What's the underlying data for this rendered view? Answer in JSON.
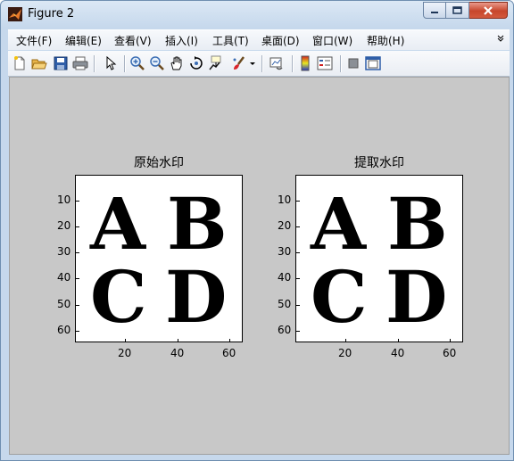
{
  "window": {
    "title": "Figure 2",
    "app_icon": "matlab-logo-icon",
    "controls": [
      "minimize-icon",
      "maximize-icon",
      "close-icon"
    ]
  },
  "menubar": {
    "items": [
      {
        "label": "文件(F)"
      },
      {
        "label": "编辑(E)"
      },
      {
        "label": "查看(V)"
      },
      {
        "label": "插入(I)"
      },
      {
        "label": "工具(T)"
      },
      {
        "label": "桌面(D)"
      },
      {
        "label": "窗口(W)"
      },
      {
        "label": "帮助(H)"
      }
    ]
  },
  "toolbar": {
    "icons": [
      "new-figure-icon",
      "open-file-icon",
      "save-icon",
      "print-icon",
      "select-arrow-icon",
      "zoom-in-icon",
      "zoom-out-icon",
      "pan-hand-icon",
      "rotate-3d-icon",
      "data-cursor-icon",
      "brush-icon",
      "brush-dropdown-icon",
      "link-plot-icon",
      "colorbar-icon",
      "legend-icon",
      "hide-plot-tools-icon",
      "show-plot-tools-icon"
    ]
  },
  "colors": {
    "figure_bg": "#c8c8c8",
    "axes_bg": "#ffffff",
    "ink": "#000000"
  },
  "plots": [
    {
      "title": "原始水印",
      "letters": [
        "A",
        "B",
        "C",
        "D"
      ],
      "yticks": [
        "10",
        "20",
        "30",
        "40",
        "50",
        "60"
      ],
      "xticks": [
        "20",
        "40",
        "60"
      ]
    },
    {
      "title": "提取水印",
      "letters": [
        "A",
        "B",
        "C",
        "D"
      ],
      "yticks": [
        "10",
        "20",
        "30",
        "40",
        "50",
        "60"
      ],
      "xticks": [
        "20",
        "40",
        "60"
      ]
    }
  ]
}
